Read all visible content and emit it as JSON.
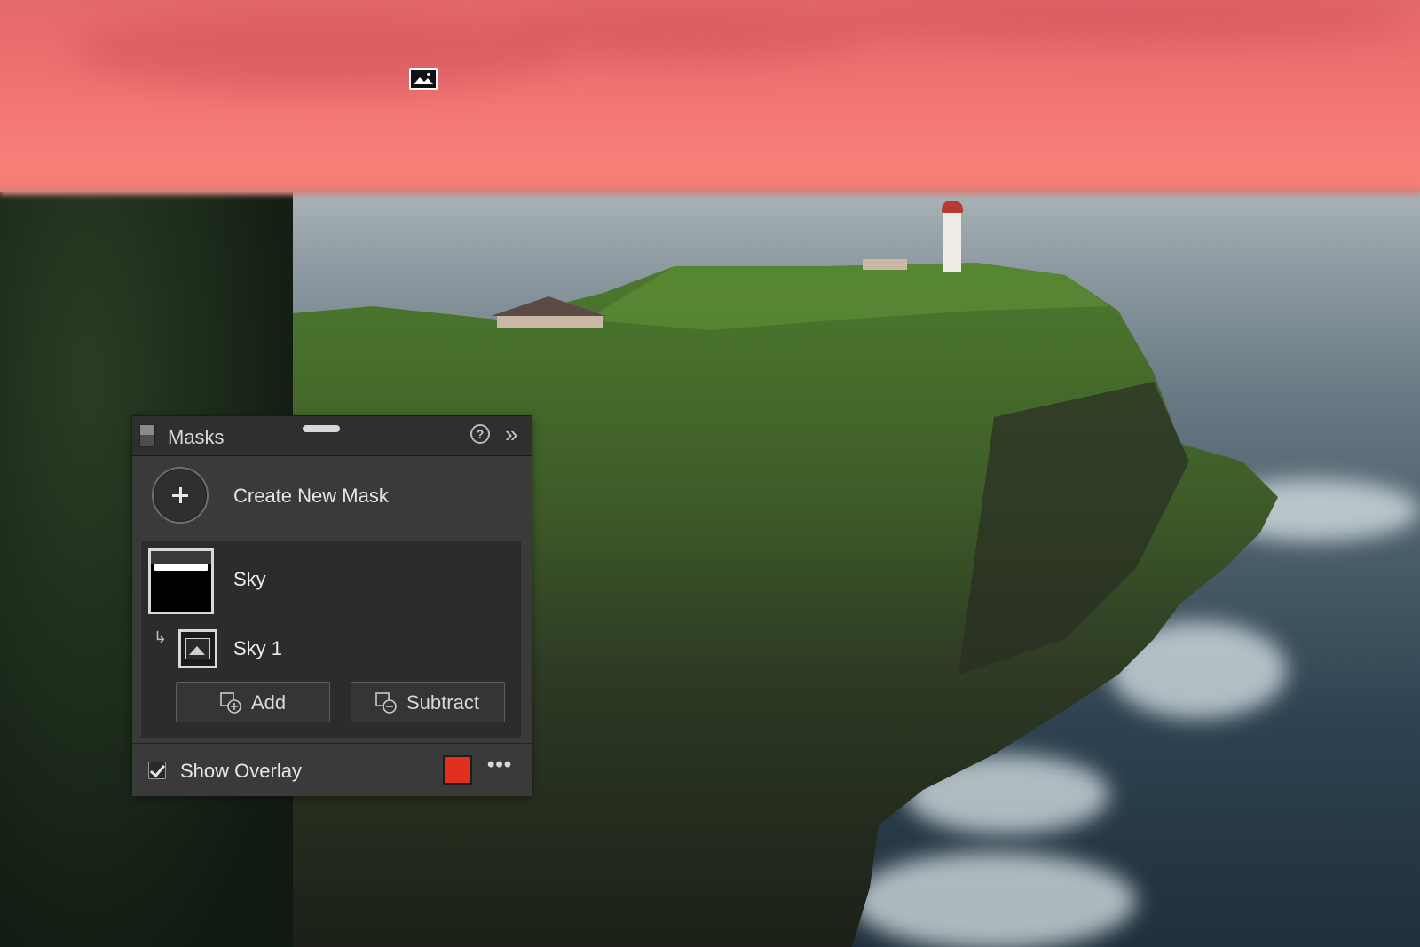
{
  "panel": {
    "title": "Masks",
    "help_label": "?",
    "collapse_label": "»"
  },
  "create": {
    "label": "Create New Mask"
  },
  "masks": [
    {
      "name": "Sky",
      "components": [
        {
          "name": "Sky 1"
        }
      ]
    }
  ],
  "actions": {
    "add_label": "Add",
    "subtract_label": "Subtract"
  },
  "footer": {
    "show_overlay_label": "Show Overlay",
    "show_overlay_checked": true,
    "overlay_color": "#e0301e",
    "more_label": "•••"
  },
  "colors": {
    "overlay_tint": "#f07170",
    "panel_bg": "#3a3a3a",
    "panel_header": "#2f2f2f"
  }
}
